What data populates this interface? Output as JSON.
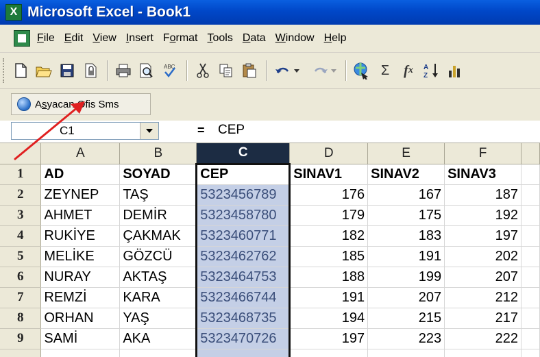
{
  "window": {
    "title": "Microsoft Excel - Book1",
    "icon": "excel-icon"
  },
  "menu": [
    {
      "pre": "",
      "u": "F",
      "post": "ile"
    },
    {
      "pre": "",
      "u": "E",
      "post": "dit"
    },
    {
      "pre": "",
      "u": "V",
      "post": "iew"
    },
    {
      "pre": "",
      "u": "I",
      "post": "nsert"
    },
    {
      "pre": "F",
      "u": "o",
      "post": "rmat"
    },
    {
      "pre": "",
      "u": "T",
      "post": "ools"
    },
    {
      "pre": "",
      "u": "D",
      "post": "ata"
    },
    {
      "pre": "",
      "u": "W",
      "post": "indow"
    },
    {
      "pre": "",
      "u": "H",
      "post": "elp"
    }
  ],
  "toolbar": {
    "icons": [
      "new-icon",
      "open-icon",
      "save-icon",
      "permission-icon",
      "print-icon",
      "print-preview-icon",
      "spelling-icon",
      "cut-icon",
      "copy-icon",
      "paste-icon",
      "undo-icon",
      "redo-icon",
      "hyperlink-icon",
      "autosum-icon",
      "function-icon",
      "sort-ascending-icon",
      "chart-icon"
    ],
    "glyphs": {
      "sigma": "Σ",
      "fx": "f",
      "fx_sub": "x"
    }
  },
  "addin": {
    "label_pre": "A",
    "label_u": "s",
    "label_post": "yacan Ofis Sms",
    "icon": "globe-icon"
  },
  "formula": {
    "name_box": "C1",
    "equals": "=",
    "value": "CEP"
  },
  "grid": {
    "columns": [
      "A",
      "B",
      "C",
      "D",
      "E",
      "F"
    ],
    "selected_column": "C",
    "rows": [
      {
        "n": "1",
        "A": "AD",
        "B": "SOYAD",
        "C": "CEP",
        "D": "SINAV1",
        "E": "SINAV2",
        "F": "SINAV3"
      },
      {
        "n": "2",
        "A": "ZEYNEP",
        "B": "TAŞ",
        "C": "5323456789",
        "D": "176",
        "E": "167",
        "F": "187"
      },
      {
        "n": "3",
        "A": "AHMET",
        "B": "DEMİR",
        "C": "5323458780",
        "D": "179",
        "E": "175",
        "F": "192"
      },
      {
        "n": "4",
        "A": "RUKİYE",
        "B": "ÇAKMAK",
        "C": "5323460771",
        "D": "182",
        "E": "183",
        "F": "197"
      },
      {
        "n": "5",
        "A": "MELİKE",
        "B": "GÖZCÜ",
        "C": "5323462762",
        "D": "185",
        "E": "191",
        "F": "202"
      },
      {
        "n": "6",
        "A": "NURAY",
        "B": "AKTAŞ",
        "C": "5323464753",
        "D": "188",
        "E": "199",
        "F": "207"
      },
      {
        "n": "7",
        "A": "REMZİ",
        "B": "KARA",
        "C": "5323466744",
        "D": "191",
        "E": "207",
        "F": "212"
      },
      {
        "n": "8",
        "A": "ORHAN",
        "B": "YAŞ",
        "C": "5323468735",
        "D": "194",
        "E": "215",
        "F": "217"
      },
      {
        "n": "9",
        "A": "SAMİ",
        "B": "AKA",
        "C": "5323470726",
        "D": "197",
        "E": "223",
        "F": "222"
      }
    ]
  },
  "colors": {
    "annotation_arrow": "#e02020",
    "selection": "#c4cfe6",
    "title_bar": "#0047c8"
  }
}
